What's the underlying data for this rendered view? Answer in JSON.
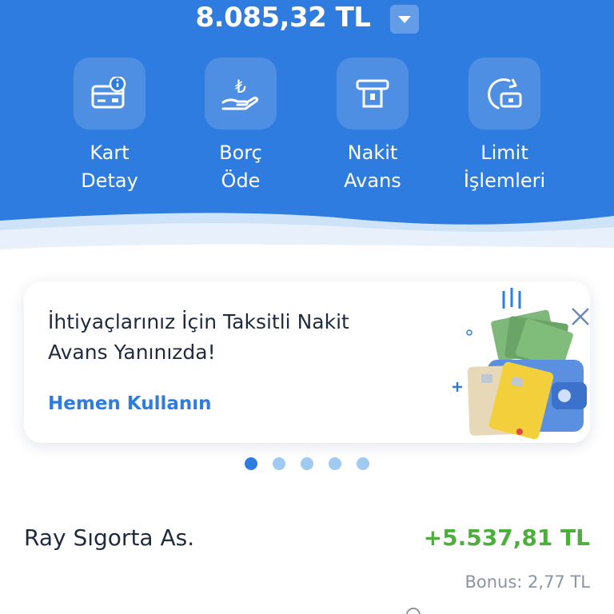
{
  "balance": {
    "amount": "8.085,32 TL"
  },
  "actions": [
    {
      "line1": "Kart",
      "line2": "Detay",
      "icon": "card-info-icon"
    },
    {
      "line1": "Borç",
      "line2": "Öde",
      "icon": "lira-hand-icon"
    },
    {
      "line1": "Nakit",
      "line2": "Avans",
      "icon": "atm-cash-icon"
    },
    {
      "line1": "Limit",
      "line2": "İşlemleri",
      "icon": "limit-refresh-icon"
    }
  ],
  "promo": {
    "title": "İhtiyaçlarınız İçin Taksitli Nakit Avans Yanınızda!",
    "link": "Hemen Kullanın",
    "art_icon": "wallet-cards-cash-illustration"
  },
  "carousel": {
    "count": 5,
    "active_index": 0
  },
  "transaction": {
    "name": "Ray Sıgorta As.",
    "amount": "+5.537,81 TL",
    "bonus": "Bonus: 2,77 TL"
  },
  "colors": {
    "primary": "#2f7ce0",
    "positive": "#4caf3c",
    "text_dark": "#1f2b3d",
    "text_muted": "#8a94a3"
  }
}
